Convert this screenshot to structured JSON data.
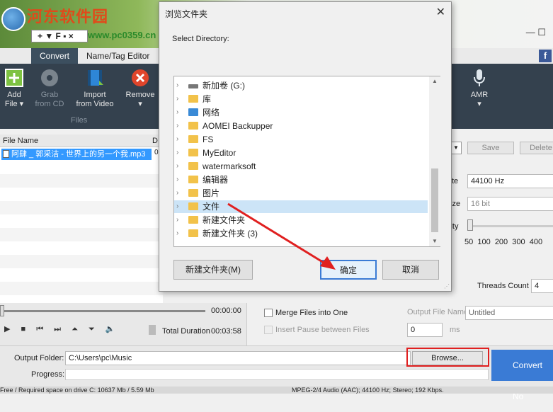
{
  "watermark": {
    "text": "河东软件园",
    "url": "www.pc0359.cn"
  },
  "app": {
    "title_field": "+ ▼ F ▪ ×",
    "window_controls": "—  ☐"
  },
  "tabs": [
    "Convert",
    "Name/Tag Editor"
  ],
  "social": "f",
  "ribbon": {
    "buttons": [
      {
        "label": "Add\nFile ▾",
        "enabled": true,
        "icon": "add-file-icon"
      },
      {
        "label": "Grab\nfrom CD",
        "enabled": false,
        "icon": "cd-icon"
      },
      {
        "label": "Import\nfrom Video",
        "enabled": true,
        "icon": "film-icon"
      },
      {
        "label": "Remove\n▾",
        "enabled": true,
        "icon": "remove-icon"
      },
      {
        "label": "AMR\n▾",
        "enabled": true,
        "icon": "microphone-icon"
      }
    ],
    "group_label": "Files"
  },
  "file_list": {
    "columns": [
      "File Name",
      "D"
    ],
    "rows": [
      {
        "name": "阿肆 _ 郭采洁 - 世界上的另一个我.mp3",
        "dur": "0("
      }
    ]
  },
  "right_pane": {
    "save_label": "Save",
    "delete_label": "Delete",
    "rate_label": "te",
    "rate_value": "44100 Hz",
    "size_label": "ize",
    "size_value": "16 bit",
    "quality_label": "lity",
    "quality_ticks": "50  100  200  300  400",
    "threads_label": "Threads Count",
    "threads_value": "4"
  },
  "player": {
    "time": "00:00:00",
    "total_label": "Total Duration",
    "total_value": "00:03:58"
  },
  "options": {
    "merge_label": "Merge Files into One",
    "pause_label": "Insert Pause between Files",
    "pause_value": "0",
    "pause_unit": "ms",
    "output_name_label": "Output File Name",
    "output_name_value": "Untitled"
  },
  "bottom": {
    "output_folder_label": "Output Folder:",
    "output_folder_value": "C:\\Users\\pc\\Music",
    "browse_label": "Browse...",
    "progress_label": "Progress:",
    "convert_label": "Convert No"
  },
  "status": {
    "left": "Free / Required space on drive  C: 10637 Mb / 5.59 Mb",
    "right": "MPEG-2/4 Audio (AAC); 44100  Hz; Stereo; 192 Kbps."
  },
  "dialog": {
    "title": "浏览文件夹",
    "close": "✕",
    "prompt": "Select Directory:",
    "tree": [
      {
        "label": "新加卷 (G:)",
        "type": "drive"
      },
      {
        "label": "库",
        "type": "lib"
      },
      {
        "label": "网络",
        "type": "net"
      },
      {
        "label": "AOMEI Backupper",
        "type": "folder"
      },
      {
        "label": "FS",
        "type": "folder"
      },
      {
        "label": "MyEditor",
        "type": "folder"
      },
      {
        "label": "watermarksoft",
        "type": "folder"
      },
      {
        "label": "编辑器",
        "type": "folder"
      },
      {
        "label": "图片",
        "type": "folder"
      },
      {
        "label": "文件",
        "type": "folder",
        "selected": true
      },
      {
        "label": "新建文件夹",
        "type": "folder"
      },
      {
        "label": "新建文件夹 (3)",
        "type": "folder"
      }
    ],
    "new_folder_label": "新建文件夹(M)",
    "ok_label": "确定",
    "cancel_label": "取消"
  },
  "colors": {
    "accent": "#3a7bd5",
    "highlight_box": "#e02020",
    "ribbon": "#34414e"
  }
}
